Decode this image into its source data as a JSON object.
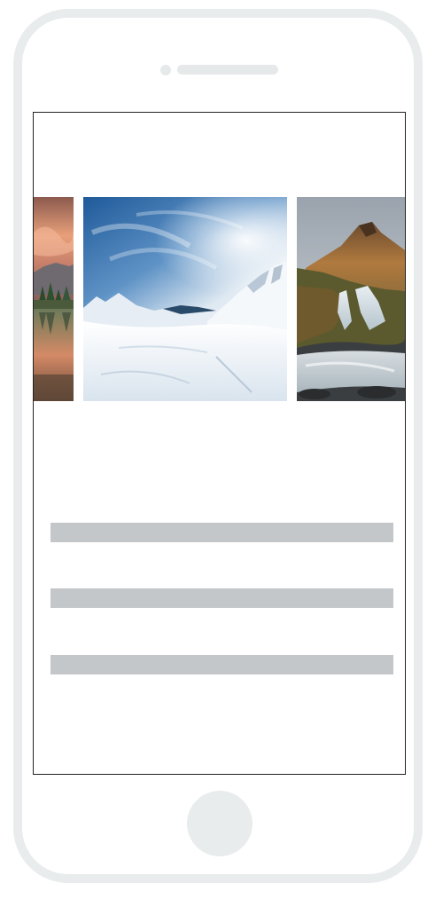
{
  "device": {
    "frame_color": "#e9eced",
    "screen_border_color": "#222222"
  },
  "carousel": {
    "slides": [
      {
        "image": "sunset-lake-image"
      },
      {
        "image": "snowy-mountain-image"
      },
      {
        "image": "waterfall-mountain-image"
      }
    ]
  },
  "text_placeholders": {
    "count": 3,
    "color": "#c3c7ca"
  }
}
